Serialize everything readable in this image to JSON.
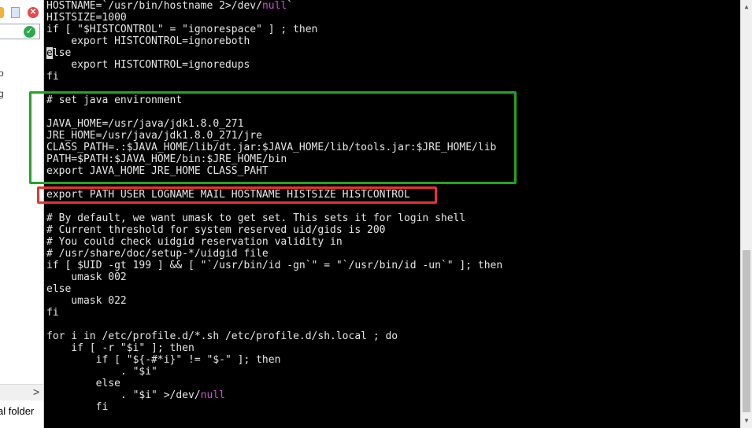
{
  "left_panel": {
    "close_icon_glyph": "✕",
    "check_icon_glyph": "✓",
    "tree_fragment_1": "o",
    "tree_fragment_2": "g",
    "scroll_right_glyph": ">",
    "bottom_label": "al folder"
  },
  "terminal": {
    "lines": [
      "HOSTNAME=`/usr/bin/hostname 2>/dev/null`",
      "HISTSIZE=1000",
      "if [ \"$HISTCONTROL\" = \"ignorespace\" ] ; then",
      "    export HISTCONTROL=ignoreboth",
      "else",
      "    export HISTCONTROL=ignoredups",
      "fi",
      "",
      "# set java environment",
      "",
      "JAVA_HOME=/usr/java/jdk1.8.0_271",
      "JRE_HOME=/usr/java/jdk1.8.0_271/jre",
      "CLASS_PATH=.:$JAVA_HOME/lib/dt.jar:$JAVA_HOME/lib/tools.jar:$JRE_HOME/lib",
      "PATH=$PATH:$JAVA_HOME/bin:$JRE_HOME/bin",
      "export JAVA_HOME JRE_HOME CLASS_PAHT",
      "export PATH USER LOGNAME MAIL HOSTNAME HISTSIZE HISTCONTROL",
      "",
      "# By default, we want umask to get set. This sets it for login shell",
      "# Current threshold for system reserved uid/gids is 200",
      "# You could check uidgid reservation validity in",
      "# /usr/share/doc/setup-*/uidgid file",
      "if [ $UID -gt 199 ] && [ \"`/usr/bin/id -gn`\" = \"`/usr/bin/id -un`\" ]; then",
      "    umask 002",
      "else",
      "    umask 022",
      "fi",
      "",
      "for i in /etc/profile.d/*.sh /etc/profile.d/sh.local ; do",
      "    if [ -r \"$i\" ]; then",
      "        if [ \"${-#*i}\" != \"$-\" ]; then",
      "            . \"$i\"",
      "        else",
      "            . \"$i\" >/dev/null",
      "        fi"
    ],
    "line0_prefix": "HOSTNAME=`/usr/bin/hostname 2>/dev/",
    "line0_keyword": "null",
    "line0_suffix": "`",
    "line4_cursor_char": "e",
    "line4_rest": "lse",
    "line32_prefix": "            . \"$i\" >/dev/",
    "line32_keyword": "null",
    "colors": {
      "background": "#000000",
      "foreground": "#e6e6e6",
      "keyword_null": "#d34fd3",
      "highlight_green": "#22a524",
      "highlight_red": "#e53430"
    }
  },
  "scrollbar": {
    "up_glyph": "▲",
    "down_glyph": "▼"
  }
}
